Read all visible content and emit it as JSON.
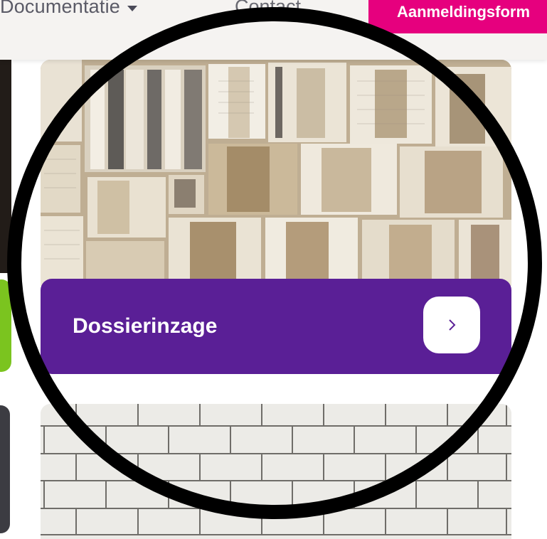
{
  "nav": {
    "documentation_label": "Documentatie",
    "contact_label": "Contact",
    "cta_label": "Aanmeldingsform"
  },
  "card": {
    "title": "Dossierinzage"
  },
  "colors": {
    "brand_magenta": "#e6007e",
    "card_purple": "#5a1f96",
    "accent_green": "#7bc41f",
    "annotation_black": "#000000"
  },
  "icons": {
    "nav_dropdown": "caret-down-icon",
    "card_arrow": "chevron-right-icon"
  }
}
